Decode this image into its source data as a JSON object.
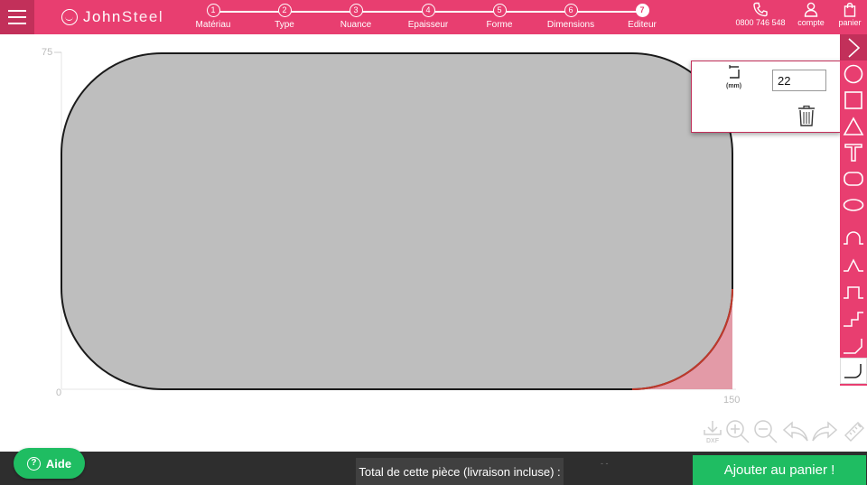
{
  "header": {
    "logo": {
      "name_bold": "John",
      "name_light": "Steel",
      "icon": "mustache-logo-icon"
    },
    "steps": [
      {
        "num": "1",
        "label": "Matériau",
        "active": false
      },
      {
        "num": "2",
        "label": "Type",
        "active": false
      },
      {
        "num": "3",
        "label": "Nuance",
        "active": false
      },
      {
        "num": "4",
        "label": "Epaisseur",
        "active": false
      },
      {
        "num": "5",
        "label": "Forme",
        "active": false
      },
      {
        "num": "6",
        "label": "Dimensions",
        "active": false
      },
      {
        "num": "7",
        "label": "Editeur",
        "active": true
      }
    ],
    "phone": "0800 746 548",
    "account_label": "compte",
    "cart_label": "panier"
  },
  "canvas": {
    "y_axis_top": "75",
    "origin": "0",
    "x_axis_right": "150"
  },
  "shape_panel": {
    "unit_label": "(mm)",
    "radius_value": "22",
    "icons": [
      "corner-radius-icon",
      "trash-icon"
    ]
  },
  "toolbar": {
    "tools": [
      "chevron-right-icon",
      "circle-icon",
      "square-icon",
      "triangle-icon",
      "text-icon",
      "rounded-rect-icon",
      "ellipse-icon",
      "arch-icon",
      "peak-icon",
      "step-notch-icon",
      "stairs-icon",
      "chamfer-corner-icon",
      "round-corner-icon"
    ]
  },
  "bottom_tools": [
    "dxf-download-icon",
    "zoom-in-icon",
    "zoom-out-icon",
    "undo-icon",
    "redo-icon",
    "ruler-icon"
  ],
  "bottom_tools_dxf_label": "DXF",
  "footer": {
    "help_label": "Aide",
    "total_label": "Total de cette pièce (livraison incluse) :",
    "price_placeholder": "- -",
    "add_to_cart_label": "Ajouter au panier !"
  },
  "colors": {
    "brand_pink": "#e83e70",
    "brand_pink_dark": "#c2305a",
    "shape_fill": "#bebebe",
    "highlight_red": "#c0392b",
    "highlight_fill": "#e39aa7",
    "green": "#1fbd62",
    "footer_bg": "#2e2e2e"
  }
}
